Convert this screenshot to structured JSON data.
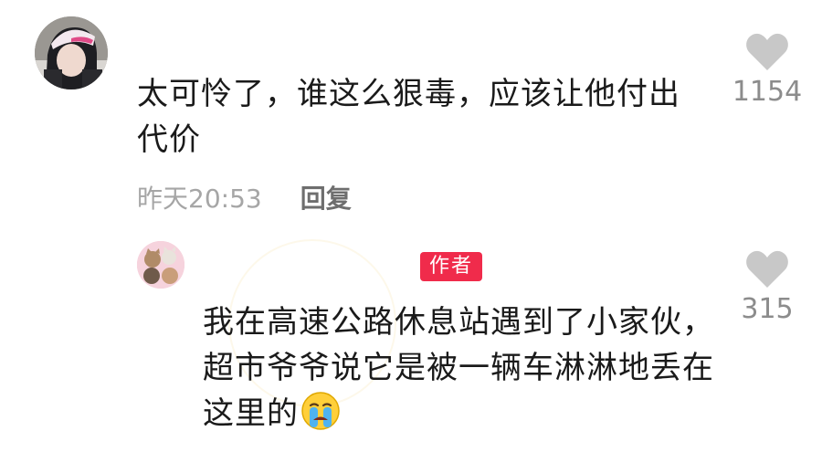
{
  "comments": [
    {
      "avatar": "user-avatar-girl-hat",
      "text": "太可怜了，谁这么狠毒，应该让他付出代价",
      "timestamp": "昨天20:53",
      "reply_label": "回复",
      "like_count": "1154",
      "like_icon": "heart-icon"
    },
    {
      "avatar": "author-avatar-kittens",
      "badge": "作者",
      "text": "我在高速公路休息站遇到了小家伙，超市爷爷说它是被一辆车淋淋地丢在这里的",
      "emoji": "crying-face-emoji",
      "like_count": "315",
      "like_icon": "heart-icon"
    }
  ],
  "colors": {
    "badge_bg": "#f02b4b",
    "text": "#1a1a1a",
    "meta": "#a6a6a6",
    "like": "#8c8c8c",
    "heart": "#c8c8c8"
  }
}
